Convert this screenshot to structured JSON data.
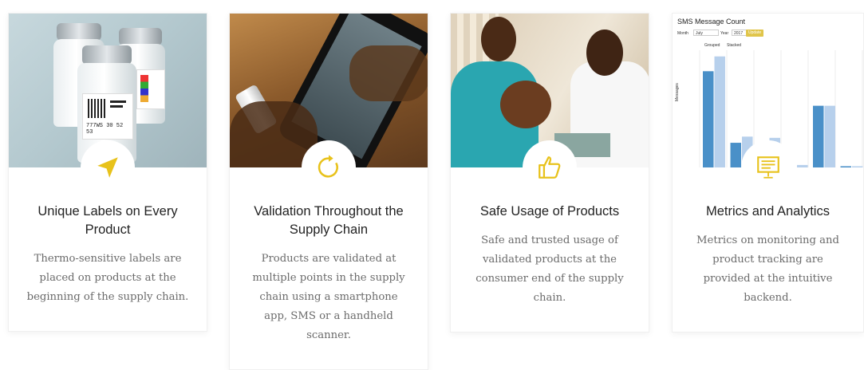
{
  "colors": {
    "accent": "#e8c21b",
    "title": "#222222",
    "desc": "#6b6b6b"
  },
  "cards": [
    {
      "icon": "navigation-arrow-icon",
      "title": "Unique Labels on Every Product",
      "description": "Thermo-sensitive labels are placed on products at the beginning of the supply chain.",
      "photo": {
        "label_code": "777WS 30 52 53"
      }
    },
    {
      "icon": "refresh-icon",
      "title": "Validation Throughout the Supply Chain",
      "description": "Products are validated at multiple points in the supply chain using a smartphone app, SMS or a handheld scanner."
    },
    {
      "icon": "thumbs-up-icon",
      "title": "Safe Usage of Products",
      "description": "Safe and trusted usage of validated products at the consumer end of the supply chain."
    },
    {
      "icon": "presentation-board-icon",
      "title": "Metrics and Analytics",
      "description": "Metrics on monitoring and product tracking are provided at the intuitive backend."
    }
  ],
  "chart_data": {
    "type": "bar",
    "title": "SMS Message Count",
    "controls": {
      "month_label": "Month",
      "month_value": "July",
      "year_label": "Year",
      "year_value": "2017",
      "update_label": "Update"
    },
    "legend": [
      "Grouped",
      "Stacked"
    ],
    "ylabel": "Messages",
    "series": [
      {
        "color": "#4a90c8",
        "values": [
          780,
          200,
          200,
          0,
          500,
          10
        ]
      },
      {
        "color": "#b7d0ec",
        "values": [
          900,
          250,
          240,
          20,
          500,
          10
        ]
      }
    ],
    "ylim": [
      0,
      950
    ]
  }
}
